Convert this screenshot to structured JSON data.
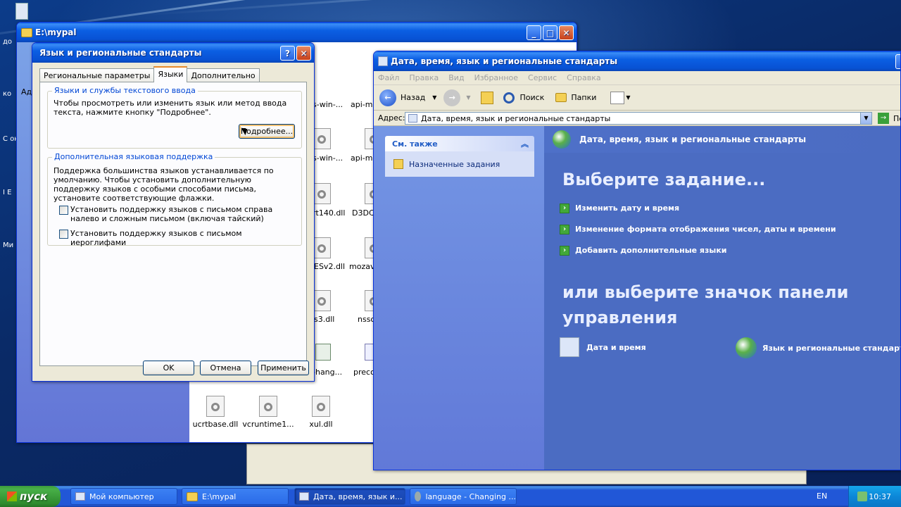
{
  "desktop": {
    "icon_labels": [
      "до",
      "ко",
      "С ок",
      "I Е",
      "Ми"
    ]
  },
  "explorer_window": {
    "title": "E:\\mypal",
    "files_partial": [
      "s-win-...",
      "api-ms-",
      "s-win-...",
      "api-ms",
      "rt140.dll",
      "D3DC",
      "ESv2.dll",
      "mozav",
      "s3.dll",
      "nssc",
      "-hang...",
      "preco"
    ],
    "files": [
      "ucrtbase.dll",
      "vcruntime1...",
      "xul.dll"
    ],
    "left_label": "Ад"
  },
  "dialog": {
    "title": "Язык и региональные стандарты",
    "tabs": [
      "Региональные параметры",
      "Языки",
      "Дополнительно"
    ],
    "group1": {
      "legend": "Языки и службы текстового ввода",
      "text": "Чтобы просмотреть или изменить язык или метод ввода текста, нажмите кнопку \"Подробнее\".",
      "details_button": "Подробнее..."
    },
    "group2": {
      "legend": "Дополнительная языковая поддержка",
      "text": "Поддержка большинства языков устанавливается по умолчанию. Чтобы установить дополнительную поддержку языков с особыми способами письма, установите соответствующие флажки.",
      "checkbox1": "Установить поддержку языков с письмом справа налево и сложным письмом (включая тайский)",
      "checkbox2": "Установить поддержку языков с письмом иероглифами"
    },
    "buttons": {
      "ok": "OK",
      "cancel": "Отмена",
      "apply": "Применить"
    }
  },
  "control_panel": {
    "title": "Дата, время, язык и региональные стандарты",
    "menu": [
      "Файл",
      "Правка",
      "Вид",
      "Избранное",
      "Сервис",
      "Справка"
    ],
    "toolbar": {
      "back": "Назад",
      "search": "Поиск",
      "folders": "Папки"
    },
    "address_label": "Адрес:",
    "address_value": "Дата, время, язык и региональные стандарты",
    "go_label": "Пе",
    "see_also": {
      "header": "См. также",
      "item": "Назначенные задания"
    },
    "main_header": "Дата, время, язык и региональные стандарты",
    "pick_task": "Выберите задание...",
    "tasks": [
      "Изменить дату и время",
      "Изменение формата отображения чисел, даты и времени",
      "Добавить дополнительные языки"
    ],
    "or_pick_line1": "или выберите значок панели",
    "or_pick_line2": "управления",
    "icons": [
      "Дата и время",
      "Язык и региональные стандарты"
    ]
  },
  "taskbar": {
    "start": "пуск",
    "items": [
      "Мой компьютер",
      "E:\\mypal",
      "Дата, время, язык и...",
      "language - Changing ..."
    ],
    "lang": "EN",
    "clock": "10:37"
  }
}
